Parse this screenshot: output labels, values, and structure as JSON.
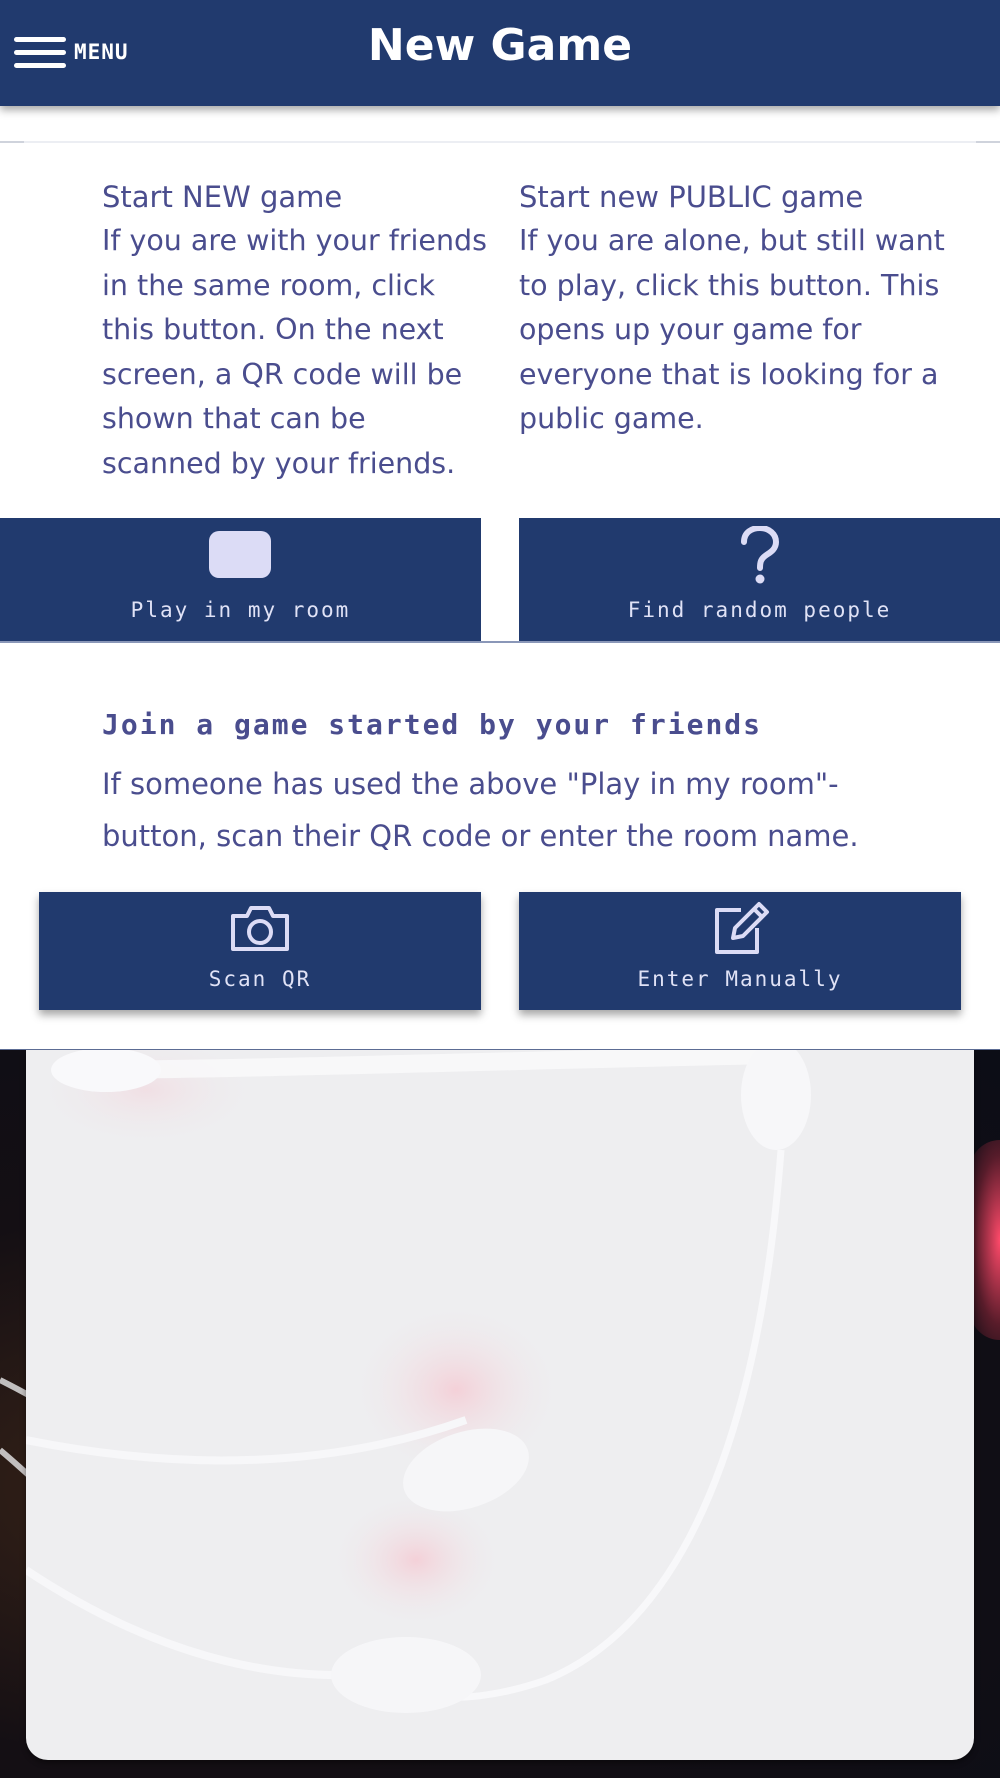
{
  "header": {
    "menu_label": "MENU",
    "title": "New Game"
  },
  "start_new": {
    "heading": "Start NEW game",
    "body": "If you are with your friends in the same room, click this button. On the next screen, a QR code will be shown that can be scanned by your friends.",
    "button_label": "Play in my room",
    "button_icon": "rounded-square-icon"
  },
  "start_public": {
    "heading": "Start new PUBLIC game",
    "body": "If you are alone, but still want to play, click this button. This opens up your game for everyone that is looking for a public game.",
    "button_label": "Find random people",
    "button_icon": "question-mark-icon"
  },
  "join": {
    "heading": "Join a game started by your friends",
    "body": "If someone has used the above \"Play in my room\"-button, scan their QR code or enter the room name.",
    "scan_label": "Scan QR",
    "scan_icon": "camera-icon",
    "manual_label": "Enter Manually",
    "manual_icon": "edit-icon"
  },
  "colors": {
    "primary": "#213a6e",
    "text": "#4a4d8e",
    "button_text": "#e0e2f6"
  }
}
